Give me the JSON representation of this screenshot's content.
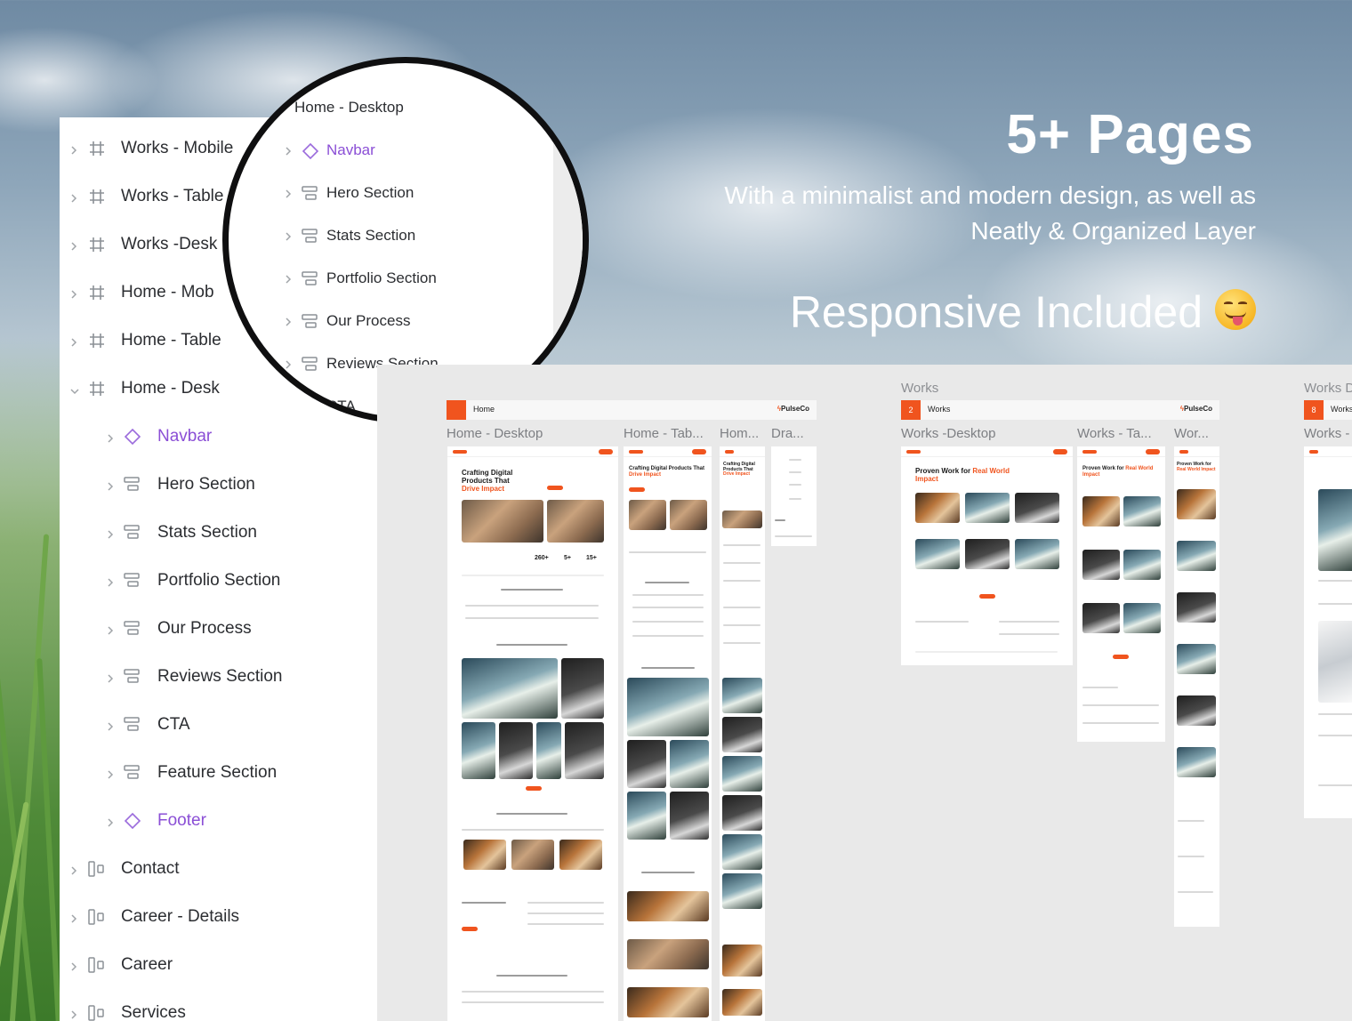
{
  "layers": {
    "frames_top": [
      {
        "label": "Works - Mobile"
      },
      {
        "label": "Works - Table"
      },
      {
        "label": "Works -Desk"
      },
      {
        "label": "Home - Mob"
      },
      {
        "label": "Home - Table"
      },
      {
        "label": "Home - Desk"
      }
    ],
    "sections": [
      {
        "label": "Navbar"
      },
      {
        "label": "Hero Section"
      },
      {
        "label": "Stats Section"
      },
      {
        "label": "Portfolio Section"
      },
      {
        "label": "Our Process"
      },
      {
        "label": "Reviews Section"
      },
      {
        "label": "CTA"
      },
      {
        "label": "Feature Section"
      },
      {
        "label": "Footer"
      }
    ],
    "pages_bottom": [
      {
        "label": "Contact"
      },
      {
        "label": "Career - Details"
      },
      {
        "label": "Career"
      },
      {
        "label": "Services"
      }
    ]
  },
  "magnifier": {
    "title": "Home - Desktop",
    "items": [
      {
        "label": "Navbar"
      },
      {
        "label": "Hero Section"
      },
      {
        "label": "Stats Section"
      },
      {
        "label": "Portfolio Section"
      },
      {
        "label": "Our Process"
      },
      {
        "label": "Reviews Section"
      },
      {
        "label": "CTA"
      }
    ]
  },
  "headline": {
    "title": "5+ Pages",
    "subtitle": "With a minimalist and modern design, as well as Neatly & Organized Layer",
    "responsive": "Responsive Included"
  },
  "canvas": {
    "home_group": {
      "bar_title": "Home",
      "logo": "PulseCo",
      "frames": [
        "Home - Desktop",
        "Home - Tab...",
        "Hom...",
        "Dra..."
      ],
      "hero_heading": "Crafting Digital Products That",
      "hero_highlight": "Drive Impact",
      "stats": [
        "260+",
        "5+",
        "15+"
      ]
    },
    "works_group": {
      "group_label": "Works",
      "bar_num": "2",
      "bar_title": "Works",
      "logo": "PulseCo",
      "frames": [
        "Works -Desktop",
        "Works - Ta...",
        "Wor..."
      ],
      "hero_heading": "Proven Work for",
      "hero_highlight": "Real World Impact"
    },
    "works_group_2": {
      "group_label": "Works D",
      "bar_num": "8",
      "bar_title": "Works",
      "frames": [
        "Works -"
      ]
    }
  },
  "colors": {
    "accent": "#f0541e",
    "purple": "#8b4fd6"
  }
}
